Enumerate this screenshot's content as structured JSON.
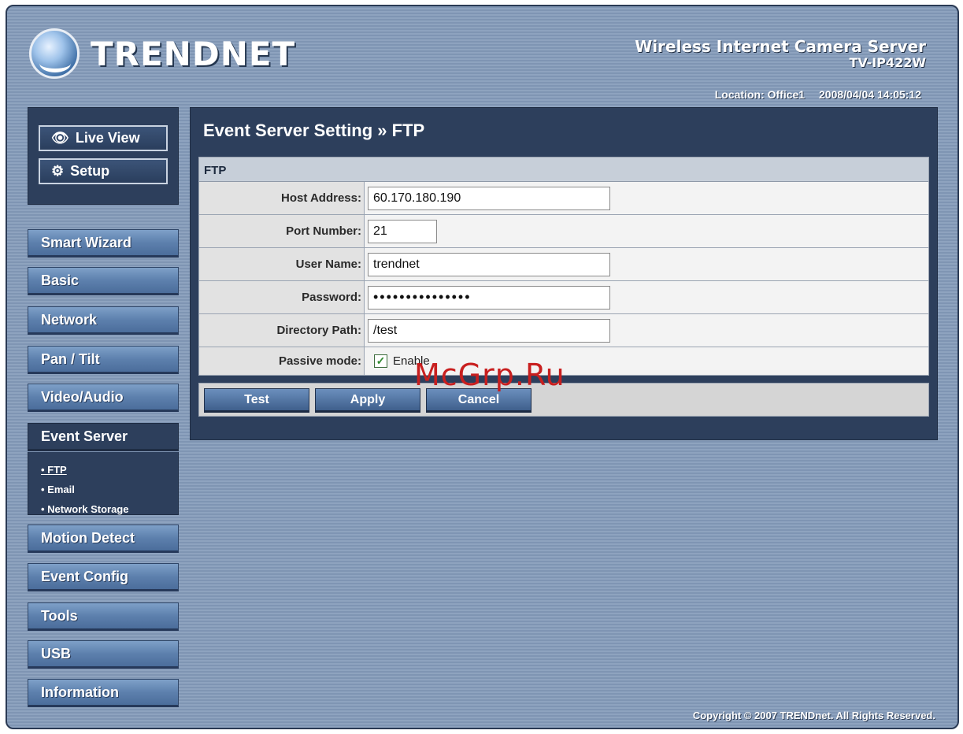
{
  "header": {
    "logo_text": "TRENDNET",
    "product_title": "Wireless Internet Camera Server",
    "product_model": "TV-IP422W",
    "location": "Location: Office1",
    "datetime": "2008/04/04 14:05:12"
  },
  "view_buttons": {
    "live_view": "Live View",
    "setup": "Setup"
  },
  "nav": {
    "smart_wizard": "Smart Wizard",
    "basic": "Basic",
    "network": "Network",
    "pan_tilt": "Pan / Tilt",
    "video_audio": "Video/Audio",
    "event_server": "Event Server",
    "motion_detect": "Motion Detect",
    "event_config": "Event Config",
    "tools": "Tools",
    "usb": "USB",
    "information": "Information"
  },
  "subnav": {
    "ftp": "• FTP",
    "email": "• Email",
    "network_storage": "• Network Storage"
  },
  "main": {
    "title": "Event Server Setting » FTP",
    "section": "FTP",
    "host_label": "Host Address:",
    "host_value": "60.170.180.190",
    "port_label": "Port Number:",
    "port_value": "21",
    "user_label": "User Name:",
    "user_value": "trendnet",
    "password_label": "Password:",
    "password_value": "•••••••••••••••",
    "dir_label": "Directory Path:",
    "dir_value": "/test",
    "passive_label": "Passive mode:",
    "passive_checked": "✓",
    "passive_enable": "Enable"
  },
  "actions": {
    "test": "Test",
    "apply": "Apply",
    "cancel": "Cancel"
  },
  "watermark": "McGrp.Ru",
  "footer": {
    "copyright": "Copyright © 2007 TRENDnet. All Rights Reserved."
  }
}
